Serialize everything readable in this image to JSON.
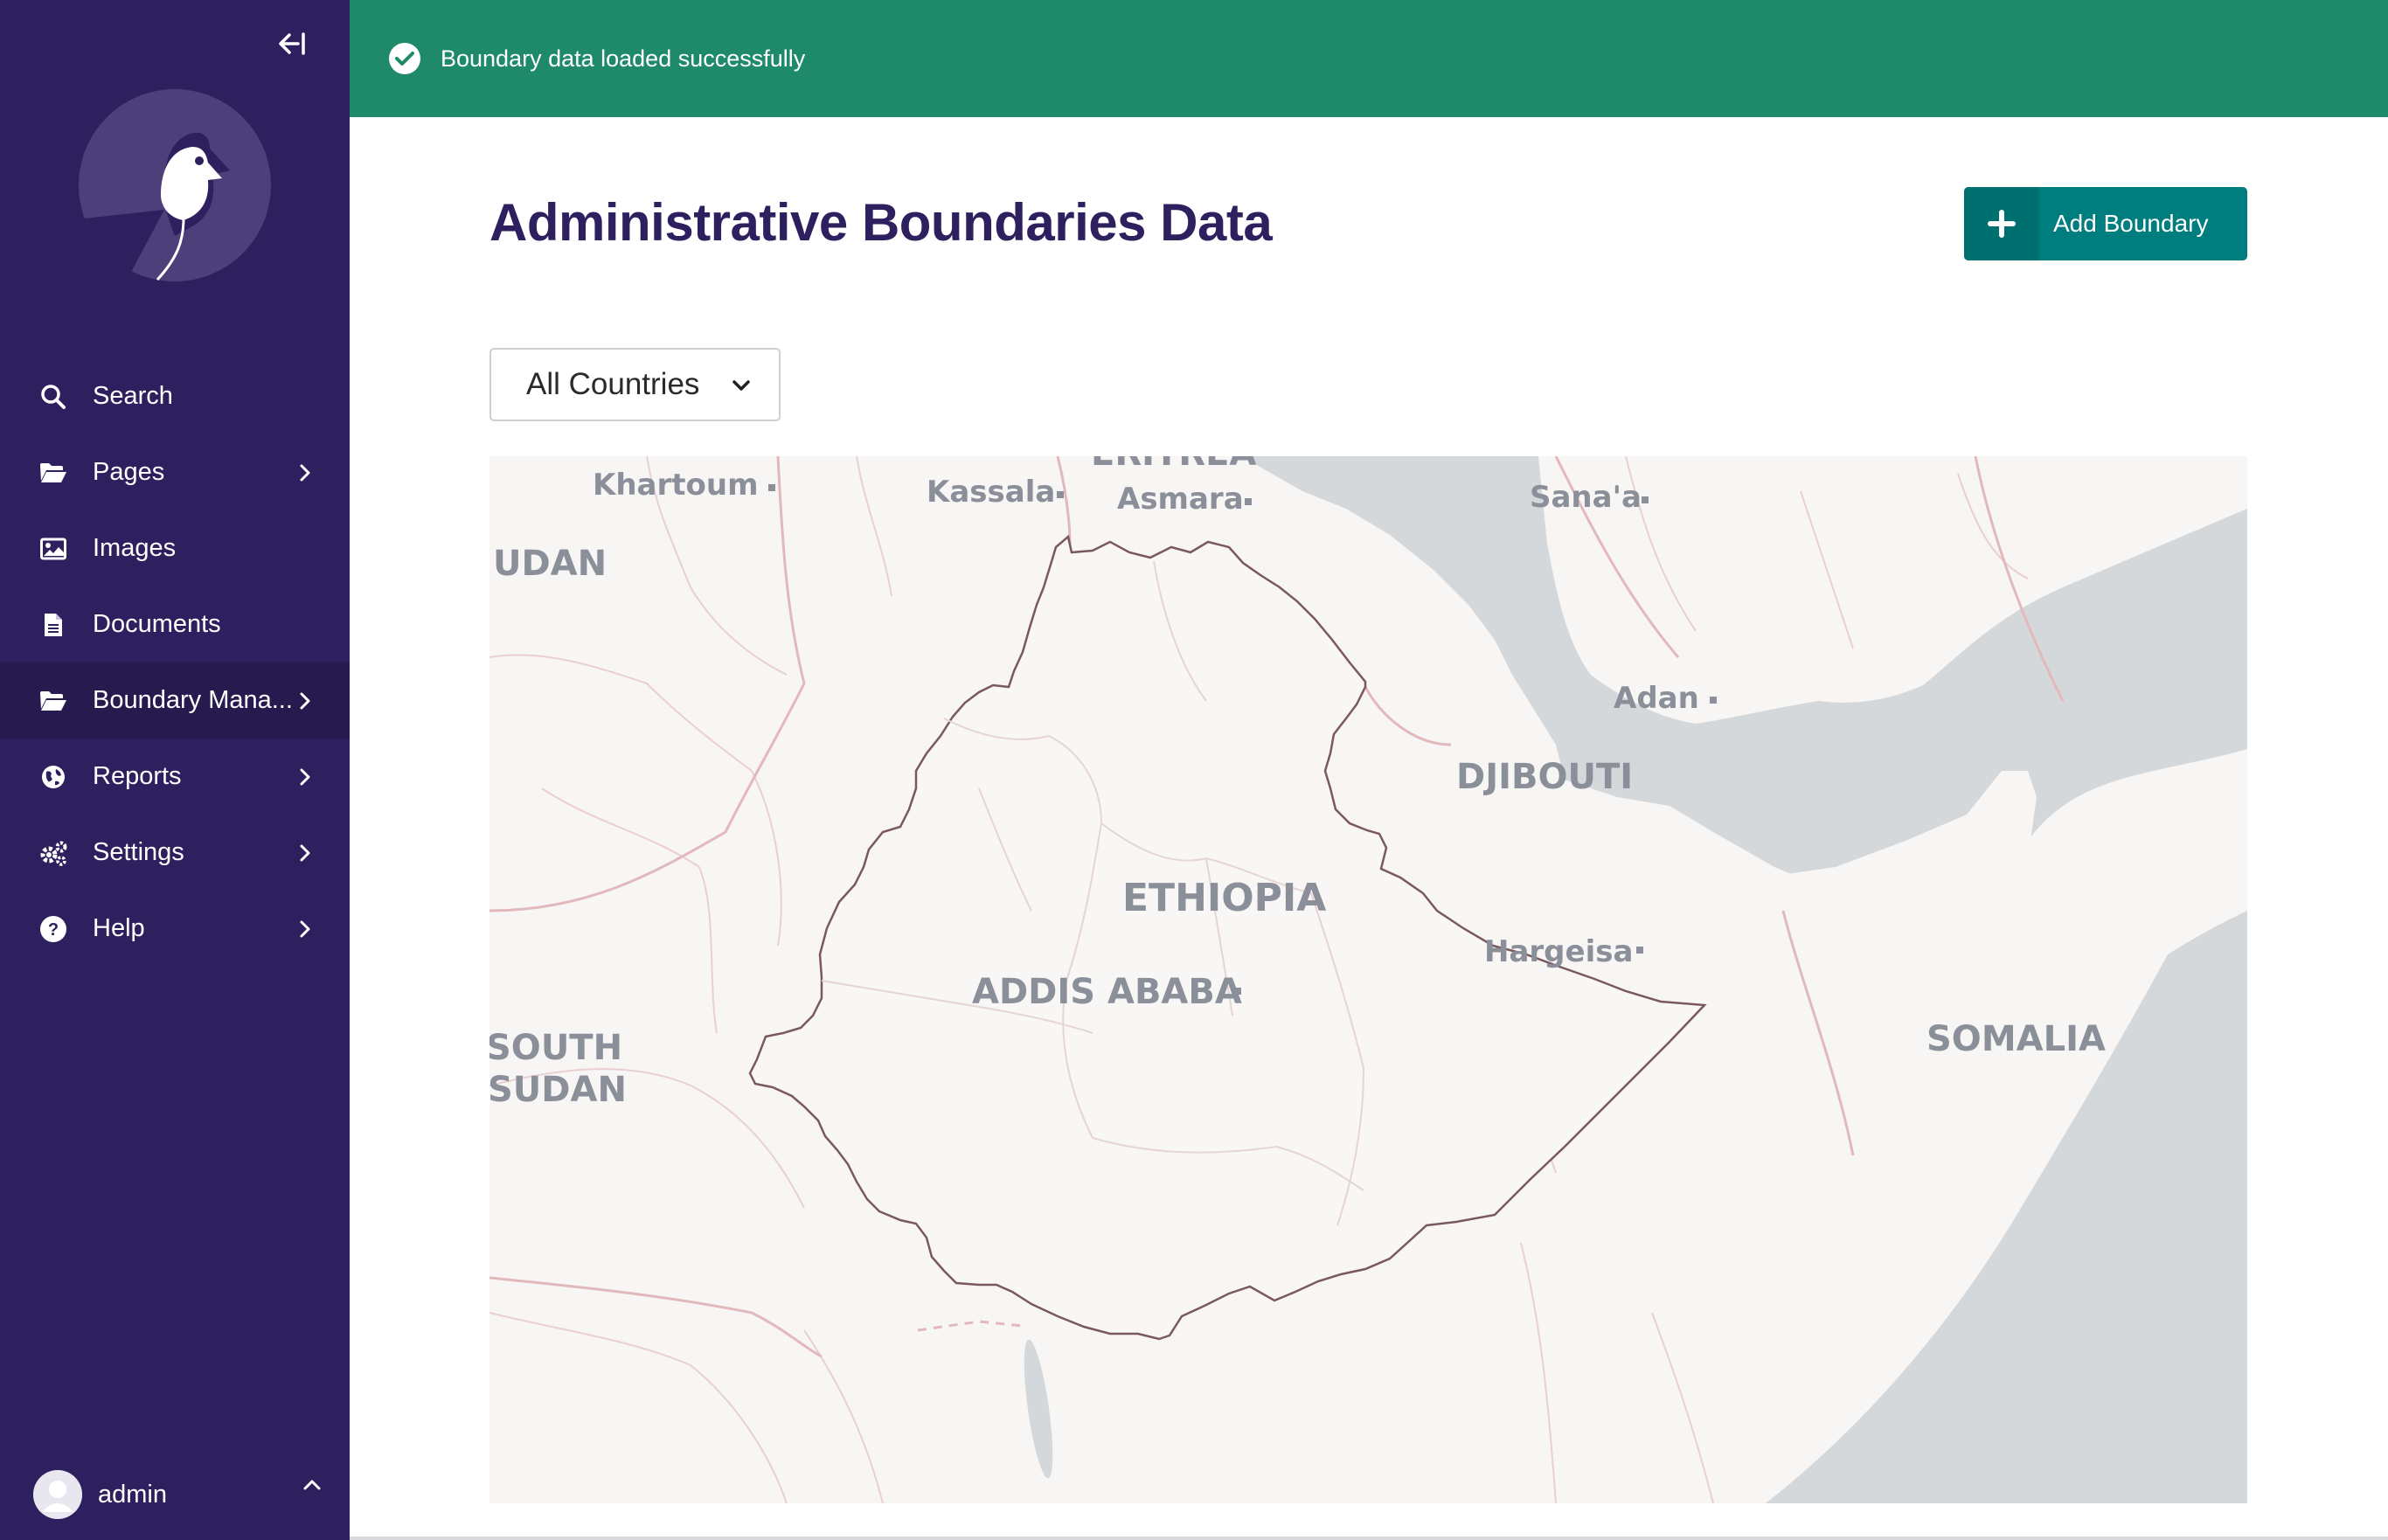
{
  "sidebar": {
    "collapse_icon": "collapse-left-icon",
    "items": [
      {
        "label": "Search",
        "icon": "search-icon",
        "has_chevron": false
      },
      {
        "label": "Pages",
        "icon": "folder-open-icon",
        "has_chevron": true
      },
      {
        "label": "Images",
        "icon": "image-icon",
        "has_chevron": false
      },
      {
        "label": "Documents",
        "icon": "document-icon",
        "has_chevron": false
      },
      {
        "label": "Boundary Mana...",
        "icon": "folder-open-icon",
        "has_chevron": true,
        "active": true
      },
      {
        "label": "Reports",
        "icon": "globe-icon",
        "has_chevron": true
      },
      {
        "label": "Settings",
        "icon": "cogs-icon",
        "has_chevron": true
      },
      {
        "label": "Help",
        "icon": "help-icon",
        "has_chevron": true
      }
    ],
    "user": {
      "name": "admin"
    }
  },
  "banner": {
    "message": "Boundary data loaded successfully",
    "icon": "check-circle-icon",
    "color": "#1e8a6a"
  },
  "header": {
    "title": "Administrative Boundaries Data"
  },
  "toolbar": {
    "add_label": "Add Boundary",
    "add_icon": "plus-icon"
  },
  "filter": {
    "selected": "All Countries"
  },
  "map": {
    "labels": {
      "khartoum": "Khartoum",
      "kassala": "Kassala",
      "eritrea": "ERITREA",
      "asmara": "Asmara",
      "sanaa": "Sana'a",
      "sudan": "UDAN",
      "adan": "Adan",
      "djibouti": "DJIBOUTI",
      "ethiopia": "ETHIOPIA",
      "hargeisa": "Hargeisa",
      "addis": "ADDIS ABABA",
      "somalia": "SOMALIA",
      "south": "SOUTH",
      "south_sudan": "SUDAN"
    }
  },
  "colors": {
    "sidebar": "#2e1f5e",
    "accent": "#007d7e",
    "title": "#2e1f5e"
  }
}
